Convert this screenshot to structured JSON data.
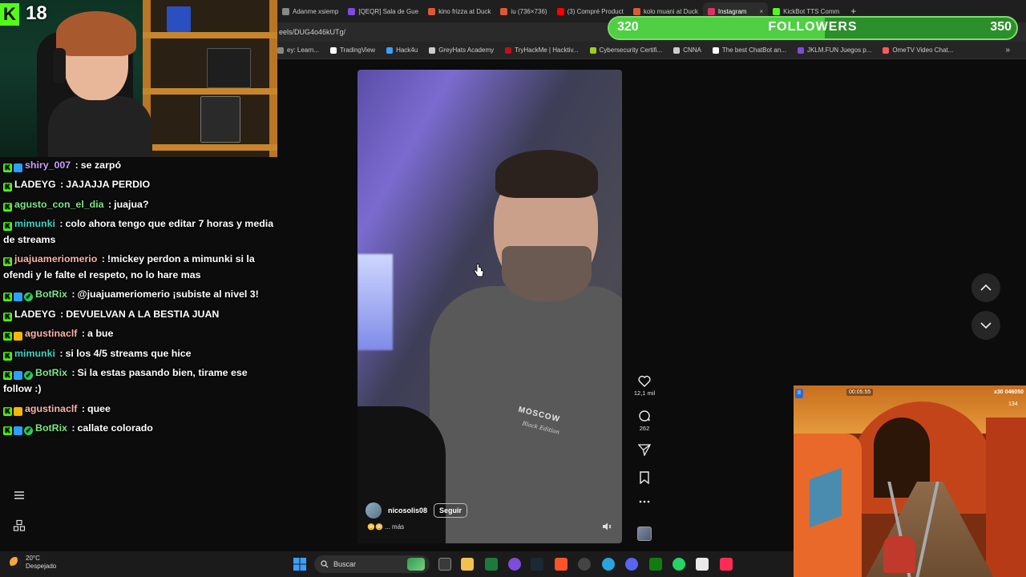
{
  "stream": {
    "viewer_count": "18",
    "followers_goal": {
      "start": "320",
      "title": "FOLLOWERS",
      "end": "350",
      "progress_fraction": 0.53
    }
  },
  "browser": {
    "tabs": [
      {
        "label": "Adanme xsiemp",
        "color": "#888888"
      },
      {
        "label": "[QEQR] Sala de Gue",
        "color": "#7d4cdb"
      },
      {
        "label": "kino frizza at Duck",
        "color": "#de5833"
      },
      {
        "label": "iu (736×736)",
        "color": "#de5833"
      },
      {
        "label": "(3) Compré Product",
        "color": "#ff0000"
      },
      {
        "label": "kolo muani at Duck",
        "color": "#de5833"
      },
      {
        "label": "Instagram",
        "color": "#e1306c",
        "active": true
      },
      {
        "label": "KickBot TTS Comm",
        "color": "#53fc18"
      }
    ],
    "new_tab_icon": "+",
    "url": "eels/DUG4o46kUTg/",
    "bookmarks": [
      {
        "label": "ey: Learn...",
        "icon": "link-icon",
        "color": "#888888"
      },
      {
        "label": "TradingView",
        "icon": "tradingview-icon",
        "color": "#ffffff"
      },
      {
        "label": "Hack4u",
        "icon": "hack4u-icon",
        "color": "#3aa0ff"
      },
      {
        "label": "GreyHats Academy",
        "icon": "greyhats-icon",
        "color": "#cccccc"
      },
      {
        "label": "TryHackMe | Hacktiv...",
        "icon": "tryhackme-icon",
        "color": "#c11111"
      },
      {
        "label": "Cybersecurity Certifi...",
        "icon": "cert-icon",
        "color": "#9ad11b"
      },
      {
        "label": "CNNA",
        "icon": "folder-icon",
        "color": "#cccccc"
      },
      {
        "label": "The best ChatBot an...",
        "icon": "chatbot-icon",
        "color": "#ffffff"
      },
      {
        "label": "JKLM.FUN Juegos p...",
        "icon": "jklm-icon",
        "color": "#7d4cdb"
      },
      {
        "label": "OmeTV Video Chat...",
        "icon": "ometv-icon",
        "color": "#ff5a5a"
      }
    ],
    "bookmarks_more": "»"
  },
  "chat": [
    {
      "user": "shiry_007",
      "color": "#c9a0ff",
      "badges": [
        "kick",
        "blue"
      ],
      "text": "se zarpó"
    },
    {
      "user": "LADEYG",
      "color": "#ffffff",
      "badges": [
        "kick"
      ],
      "text": "JAJAJJA PERDIO"
    },
    {
      "user": "agusto_con_el_dia",
      "color": "#7ee787",
      "badges": [
        "kick"
      ],
      "text": "juajua?"
    },
    {
      "user": "mimunki",
      "color": "#3dd6c4",
      "badges": [
        "kick"
      ],
      "text": "colo ahora tengo que editar 7 horas y media de streams"
    },
    {
      "user": "juajuameriomerio",
      "color": "#ffb3a7",
      "badges": [
        "kick"
      ],
      "text": "!mickey perdon a mimunki si la ofendi y le falte el respeto, no lo hare mas"
    },
    {
      "user": "BotRix",
      "color": "#7ee787",
      "badges": [
        "kick",
        "blue",
        "green"
      ],
      "text": "@juajuameriomerio ¡subiste al nivel 3!"
    },
    {
      "user": "LADEYG",
      "color": "#ffffff",
      "badges": [
        "kick"
      ],
      "text": "DEVUELVAN A LA BESTIA JUAN"
    },
    {
      "user": "agustinaclf",
      "color": "#ffb3a7",
      "badges": [
        "kick",
        "gold"
      ],
      "text": "a bue"
    },
    {
      "user": "mimunki",
      "color": "#3dd6c4",
      "badges": [
        "kick"
      ],
      "text": "si los 4/5 streams que hice"
    },
    {
      "user": "BotRix",
      "color": "#7ee787",
      "badges": [
        "kick",
        "blue",
        "green"
      ],
      "text": "Si la estas pasando bien, tirame ese follow :)"
    },
    {
      "user": "agustinaclf",
      "color": "#ffb3a7",
      "badges": [
        "kick",
        "gold"
      ],
      "text": "quee"
    },
    {
      "user": "BotRix",
      "color": "#7ee787",
      "badges": [
        "kick",
        "blue",
        "green"
      ],
      "text": "callate colorado"
    }
  ],
  "reel": {
    "shirt_text": "MOSCOW",
    "shirt_subtext": "Black Edition",
    "author": "nicosolis08",
    "follow_label": "Seguir",
    "caption": "😳😳 ... más",
    "likes": "12,1 mil",
    "comments": "262"
  },
  "game": {
    "timer": "00:05:55",
    "score": "x30 046050",
    "coins": "134"
  },
  "taskbar": {
    "weather_temp": "20°C",
    "weather_desc": "Despejado",
    "search_label": "Buscar"
  }
}
